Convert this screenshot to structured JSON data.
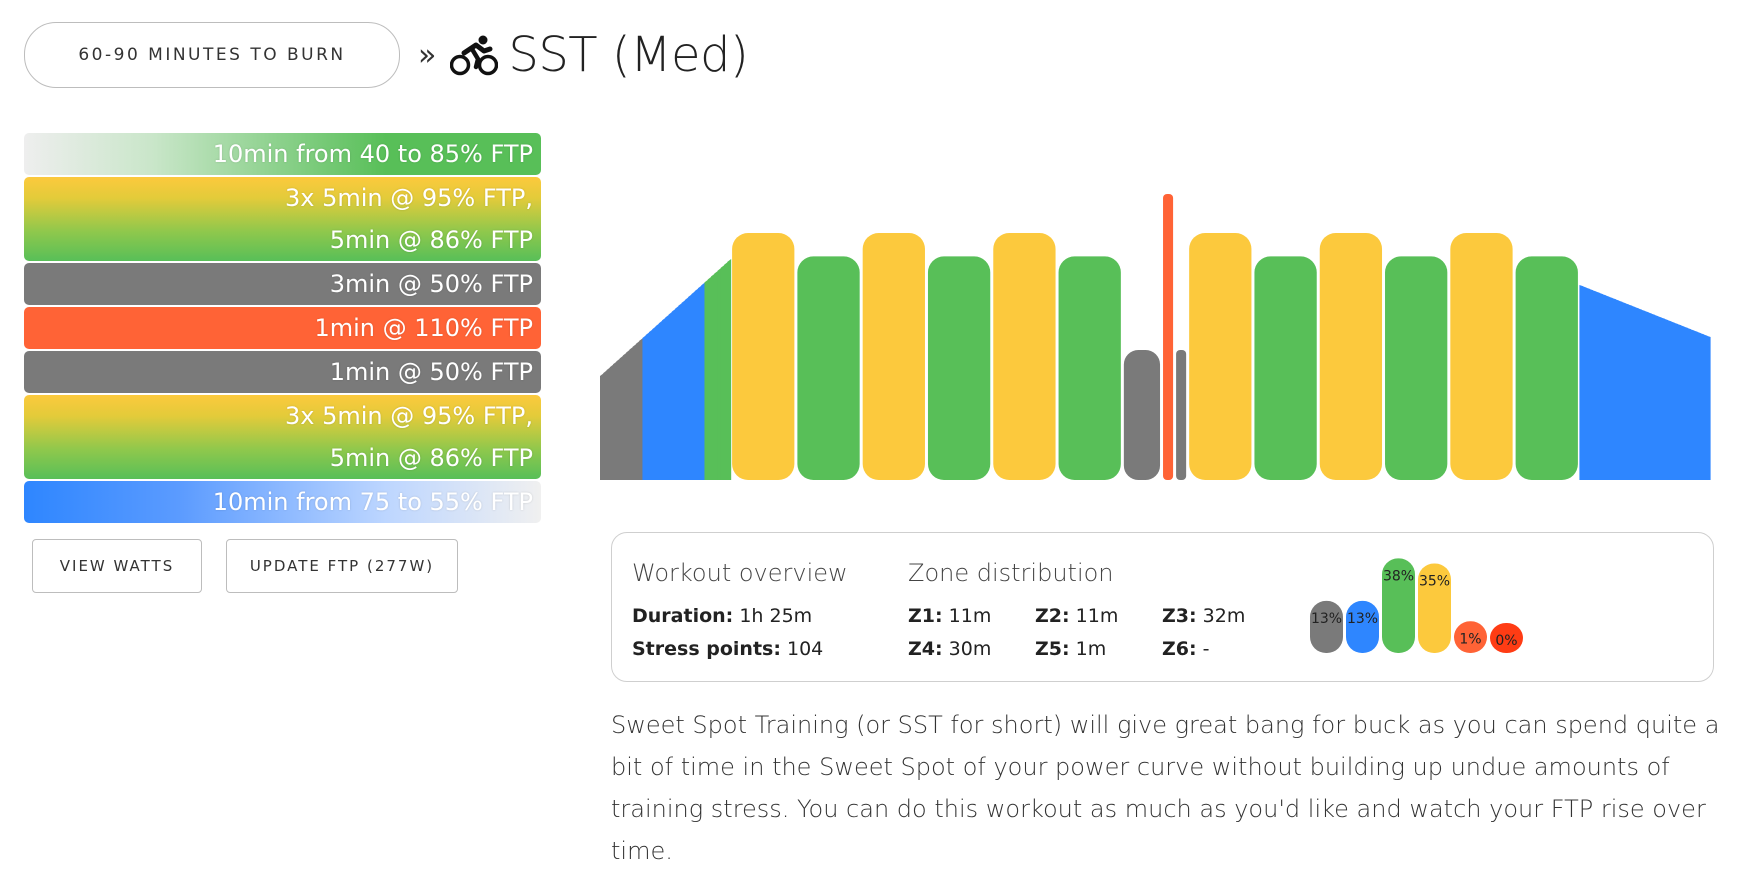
{
  "header": {
    "burn_button": "60-90 MINUTES TO BURN",
    "chevron": "»",
    "bike_icon": "bicycle-rider-icon",
    "title": "SST (Med)"
  },
  "segments": [
    {
      "lines": [
        "10min from 40 to 85% FTP"
      ],
      "style": "warm"
    },
    {
      "lines": [
        "3x 5min @ 95% FTP,",
        "5min @ 86% FTP"
      ],
      "style": "interval"
    },
    {
      "lines": [
        "3min @ 50% FTP"
      ],
      "style": "grey"
    },
    {
      "lines": [
        "1min @ 110% FTP"
      ],
      "style": "red"
    },
    {
      "lines": [
        "1min @ 50% FTP"
      ],
      "style": "grey"
    },
    {
      "lines": [
        "3x 5min @ 95% FTP,",
        "5min @ 86% FTP"
      ],
      "style": "interval"
    },
    {
      "lines": [
        "10min from 75 to 55% FTP"
      ],
      "style": "cool"
    }
  ],
  "buttons": {
    "view_watts": "VIEW WATTS",
    "update_ftp": "UPDATE FTP (277W)"
  },
  "colors": {
    "z1": "#7a7a7a",
    "z2": "#2e86ff",
    "z3": "#58bf58",
    "z4": "#fcc93d",
    "z5": "#ff6336",
    "z6": "#ff3c14"
  },
  "overview": {
    "heading": "Workout overview",
    "duration_label": "Duration:",
    "duration_value": "1h 25m",
    "stress_label": "Stress points:",
    "stress_value": "104"
  },
  "zones": {
    "heading": "Zone distribution",
    "items": [
      {
        "label": "Z1:",
        "value": "11m"
      },
      {
        "label": "Z2:",
        "value": "11m"
      },
      {
        "label": "Z3:",
        "value": "32m"
      },
      {
        "label": "Z4:",
        "value": "30m"
      },
      {
        "label": "Z5:",
        "value": "1m"
      },
      {
        "label": "Z6:",
        "value": "-"
      }
    ],
    "percent_labels": [
      "13%",
      "13%",
      "38%",
      "35%",
      "1%",
      "0%"
    ],
    "percent_values": [
      13,
      13,
      38,
      35,
      1,
      0
    ]
  },
  "workout_profile": [
    {
      "type": "ramp",
      "from": 40,
      "to": 85,
      "minutes": 10
    },
    {
      "type": "steady",
      "pct": 95,
      "minutes": 5,
      "zone": "z4"
    },
    {
      "type": "steady",
      "pct": 86,
      "minutes": 5,
      "zone": "z3"
    },
    {
      "type": "steady",
      "pct": 95,
      "minutes": 5,
      "zone": "z4"
    },
    {
      "type": "steady",
      "pct": 86,
      "minutes": 5,
      "zone": "z3"
    },
    {
      "type": "steady",
      "pct": 95,
      "minutes": 5,
      "zone": "z4"
    },
    {
      "type": "steady",
      "pct": 86,
      "minutes": 5,
      "zone": "z3"
    },
    {
      "type": "steady",
      "pct": 50,
      "minutes": 3,
      "zone": "z1"
    },
    {
      "type": "steady",
      "pct": 110,
      "minutes": 1,
      "zone": "z5"
    },
    {
      "type": "steady",
      "pct": 50,
      "minutes": 1,
      "zone": "z1"
    },
    {
      "type": "steady",
      "pct": 95,
      "minutes": 5,
      "zone": "z4"
    },
    {
      "type": "steady",
      "pct": 86,
      "minutes": 5,
      "zone": "z3"
    },
    {
      "type": "steady",
      "pct": 95,
      "minutes": 5,
      "zone": "z4"
    },
    {
      "type": "steady",
      "pct": 86,
      "minutes": 5,
      "zone": "z3"
    },
    {
      "type": "steady",
      "pct": 95,
      "minutes": 5,
      "zone": "z4"
    },
    {
      "type": "steady",
      "pct": 86,
      "minutes": 5,
      "zone": "z3"
    },
    {
      "type": "ramp",
      "from": 75,
      "to": 55,
      "minutes": 10
    }
  ],
  "description": "Sweet Spot Training (or SST for short) will give great bang for buck as you can spend quite a bit of time in the Sweet Spot of your power curve without building up undue amounts of training stress. You can do this workout as much as you'd like and watch your FTP rise over time."
}
